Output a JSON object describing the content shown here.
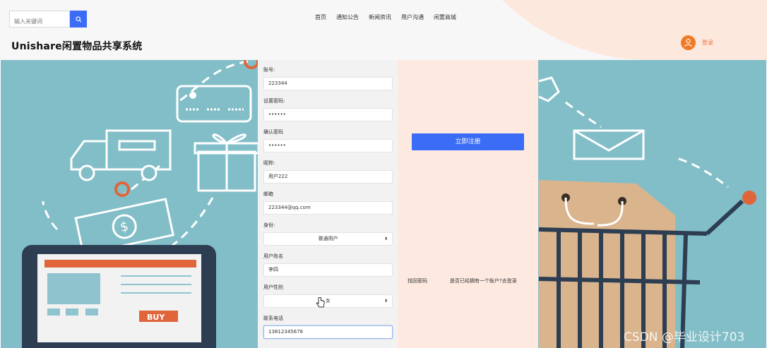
{
  "header": {
    "search_placeholder": "输入关键词",
    "nav": [
      "首页",
      "通知公告",
      "新闻资讯",
      "用户沟通",
      "闲置商城"
    ],
    "site_title": "Unishare闲置物品共享系统",
    "login_label": "登录"
  },
  "form": {
    "fields": [
      {
        "label": "账号:",
        "value": "223344"
      },
      {
        "label": "设置密码:",
        "value": "••••••"
      },
      {
        "label": "确认密码",
        "value": "••••••"
      },
      {
        "label": "昵称:",
        "value": "用户222"
      },
      {
        "label": "邮箱",
        "value": "223344@qq.com"
      },
      {
        "label": "身份:",
        "value": "普通用户"
      },
      {
        "label": "用户姓名",
        "value": "李四"
      },
      {
        "label": "用户性别",
        "value": "女"
      },
      {
        "label": "联系电话",
        "value": "13812345678"
      }
    ]
  },
  "actions": {
    "register": "立即注册",
    "forgot": "找回密码",
    "have_account": "是否已经拥有一个账户?去登录"
  },
  "illustration": {
    "buy_label": "BUY"
  },
  "watermark": "CSDN @毕业设计703",
  "colors": {
    "accent": "#3b6cf6",
    "background_teal": "#82bec8",
    "pink_panel": "#fde9e0",
    "orange": "#f07b27"
  }
}
